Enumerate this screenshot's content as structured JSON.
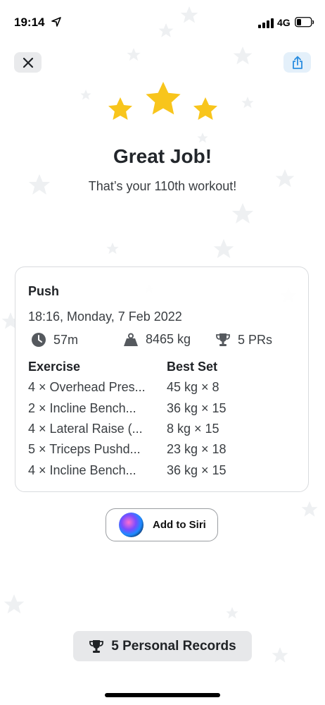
{
  "status_bar": {
    "time": "19:14",
    "network": "4G"
  },
  "header": {
    "close_icon": "close-icon",
    "share_icon": "share-icon"
  },
  "celebration": {
    "stars": 3,
    "title": "Great Job!",
    "subtitle": "That’s your 110th workout!"
  },
  "workout": {
    "name": "Push",
    "date": "18:16, Monday, 7 Feb 2022",
    "stats": {
      "duration": "57m",
      "volume": "8465 kg",
      "prs": "5 PRs"
    },
    "columns": {
      "exercise": "Exercise",
      "best_set": "Best Set"
    },
    "rows": [
      {
        "exercise": "4 × Overhead Pres...",
        "best_set": "45 kg × 8"
      },
      {
        "exercise": "2 × Incline Bench...",
        "best_set": "36 kg × 15"
      },
      {
        "exercise": "4 × Lateral Raise (...",
        "best_set": "8 kg × 15"
      },
      {
        "exercise": "5 × Triceps Pushd...",
        "best_set": "23 kg × 18"
      },
      {
        "exercise": "4 × Incline Bench...",
        "best_set": "36 kg × 15"
      }
    ]
  },
  "siri": {
    "label": "Add to Siri"
  },
  "records": {
    "label": "5 Personal Records"
  },
  "colors": {
    "star": "#f8c51c",
    "accent": "#2a8de0"
  }
}
